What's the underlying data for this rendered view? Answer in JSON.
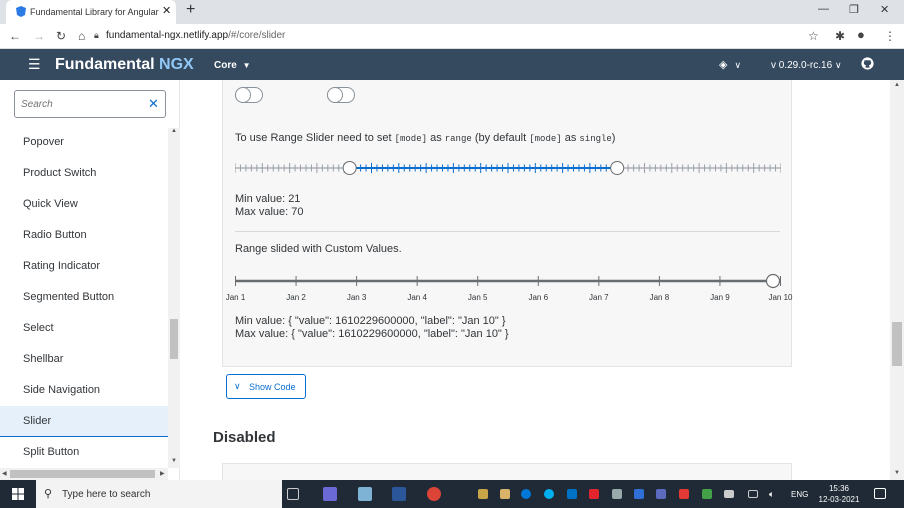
{
  "browser": {
    "tab_title": "Fundamental Library for Angular",
    "url_host": "fundamental-ngx.netlify.app",
    "url_path": "/#/core/slider",
    "new_tab": "+",
    "tab_close": "✕"
  },
  "header": {
    "brand_main": "Fundamental",
    "brand_accent": "NGX",
    "menu_label": "Core",
    "version": "v 0.29.0-rc.16"
  },
  "sidebar": {
    "search_placeholder": "Search",
    "items": [
      {
        "label": "Popover"
      },
      {
        "label": "Product Switch"
      },
      {
        "label": "Quick View"
      },
      {
        "label": "Radio Button"
      },
      {
        "label": "Rating Indicator"
      },
      {
        "label": "Segmented Button"
      },
      {
        "label": "Select"
      },
      {
        "label": "Shellbar"
      },
      {
        "label": "Side Navigation"
      },
      {
        "label": "Slider"
      },
      {
        "label": "Split Button"
      }
    ],
    "selected_index": 9
  },
  "main": {
    "range_intro_1": "To use Range Slider need to set ",
    "range_intro_code1": "[mode]",
    "range_intro_2": " as ",
    "range_intro_code2": "range",
    "range_intro_3": " (by default ",
    "range_intro_code3": "[mode]",
    "range_intro_4": " as ",
    "range_intro_code4": "single",
    "range_intro_5": ")",
    "range_slider": {
      "min": 0,
      "max": 100,
      "low": 21,
      "high": 70
    },
    "min_value_text": "Min value: 21",
    "max_value_text": "Max value: 70",
    "custom_title": "Range slided with Custom Values.",
    "custom_labels": [
      "Jan 1",
      "Jan 2",
      "Jan 3",
      "Jan 4",
      "Jan 5",
      "Jan 6",
      "Jan 7",
      "Jan 8",
      "Jan 9",
      "Jan 10"
    ],
    "custom_selected_index": 9,
    "custom_min_text": "Min value: { \"value\": 1610229600000, \"label\": \"Jan 10\" }",
    "custom_max_text": "Max value: { \"value\": 1610229600000, \"label\": \"Jan 10\" }",
    "show_code_label": "Show Code",
    "disabled_title": "Disabled"
  },
  "taskbar": {
    "search_label": "Type here to search",
    "lang": "ENG",
    "time": "15:36",
    "date": "12-03-2021"
  },
  "colors": {
    "header_bg": "#354a5f",
    "accent": "#0a6ed1",
    "brand_accent": "#91c8f6",
    "range_fill": "#0a6ed1"
  }
}
